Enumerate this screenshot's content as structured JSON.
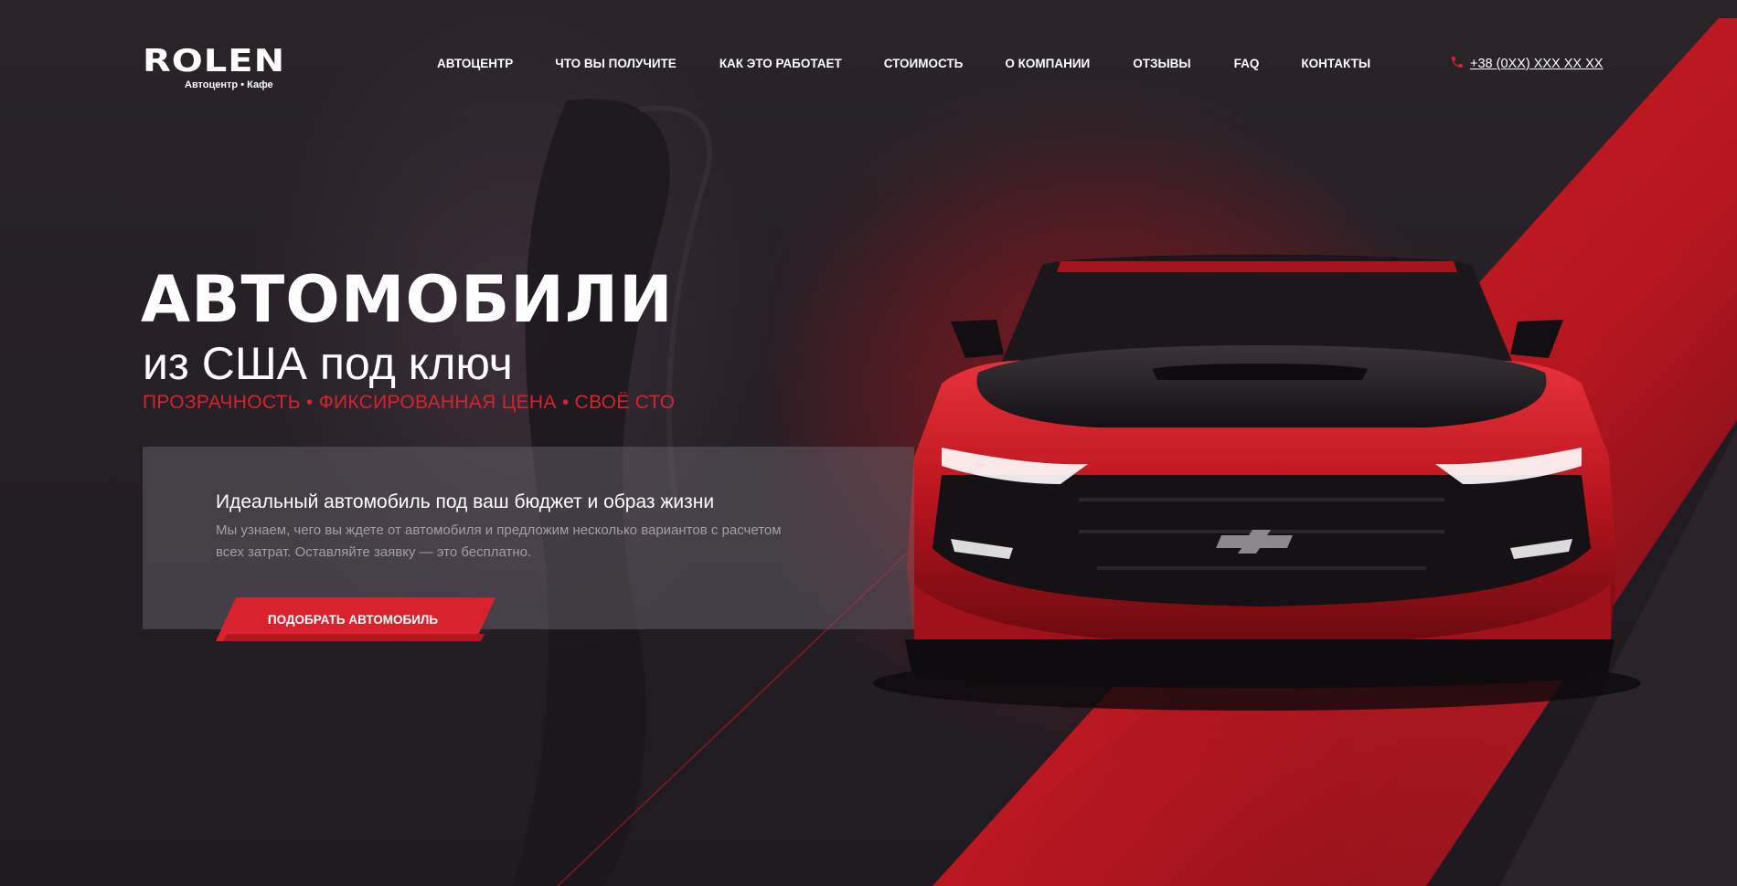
{
  "brand": {
    "logo_text": "ROLEN",
    "logo_subtitle": "Автоцентр • Кафе"
  },
  "nav": {
    "items": [
      {
        "label": "АВТОЦЕНТР"
      },
      {
        "label": "ЧТО ВЫ ПОЛУЧИТЕ"
      },
      {
        "label": "КАК ЭТО РАБОТАЕТ"
      },
      {
        "label": "СТОИМОСТЬ"
      },
      {
        "label": "О КОМПАНИИ"
      },
      {
        "label": "ОТЗЫВЫ"
      },
      {
        "label": "FAQ"
      },
      {
        "label": "КОНТАКТЫ"
      }
    ]
  },
  "contact": {
    "phone_icon": "phone-icon",
    "phone": "+38 (0XX) XXX XX XX"
  },
  "hero": {
    "title": "АВТОМОБИЛИ",
    "subtitle": "из США под ключ",
    "tagline": "ПРОЗРАЧНОСТЬ • ФИКСИРОВАННАЯ ЦЕНА • СВОЁ СТО",
    "card_title": "Идеальный автомобиль под ваш бюджет и образ жизни",
    "card_text": "Мы узнаем, чего вы ждете от автомобиля и предложим несколько вариантов с расчетом всех затрат. Оставляйте заявку — это бесплатно.",
    "cta_label": "ПОДОБРАТЬ АВТОМОБИЛЬ",
    "image": "red-sports-car"
  },
  "colors": {
    "accent": "#d8232e",
    "background": "#221e24",
    "card": "#6e6870"
  }
}
